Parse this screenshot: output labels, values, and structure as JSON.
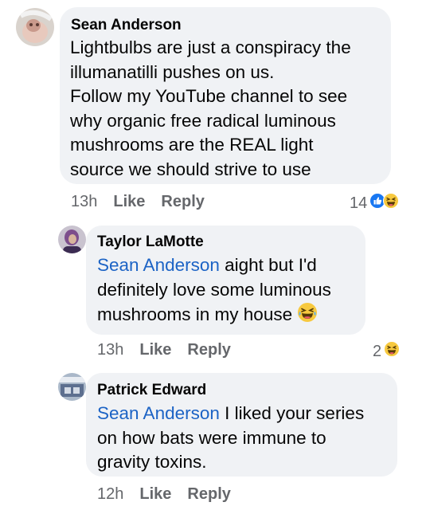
{
  "colors": {
    "bubble": "#f0f2f5",
    "mention": "#1c63c5",
    "meta": "#65676b",
    "like_blue": "#1877f2",
    "haha_yellow": "#f7c93f"
  },
  "comments": [
    {
      "author": "Sean Anderson",
      "lines": [
        "Lightbulbs are just a conspiracy the",
        "illumanatilli pushes on us.",
        "Follow my YouTube channel to see",
        "why organic free radical luminous",
        "mushrooms are the REAL light",
        "source we should strive to use"
      ],
      "time": "13h",
      "like_label": "Like",
      "reply_label": "Reply",
      "reaction_count": "14",
      "reaction_icons": [
        "like-icon",
        "haha-icon"
      ]
    },
    {
      "author": "Taylor LaMotte",
      "mention": "Sean Anderson",
      "line1_rest": " aight but I'd",
      "line2": "definitely love some luminous",
      "line3": "mushrooms in my house",
      "emoji": "haha-emoji",
      "time": "13h",
      "like_label": "Like",
      "reply_label": "Reply",
      "reaction_count": "2",
      "reaction_icons": [
        "haha-icon"
      ]
    },
    {
      "author": "Patrick Edward",
      "mention": "Sean Anderson",
      "line1_rest": " I liked your series",
      "line2": "on how bats were immune to",
      "line3": "gravity toxins.",
      "time": "12h",
      "like_label": "Like",
      "reply_label": "Reply"
    }
  ]
}
